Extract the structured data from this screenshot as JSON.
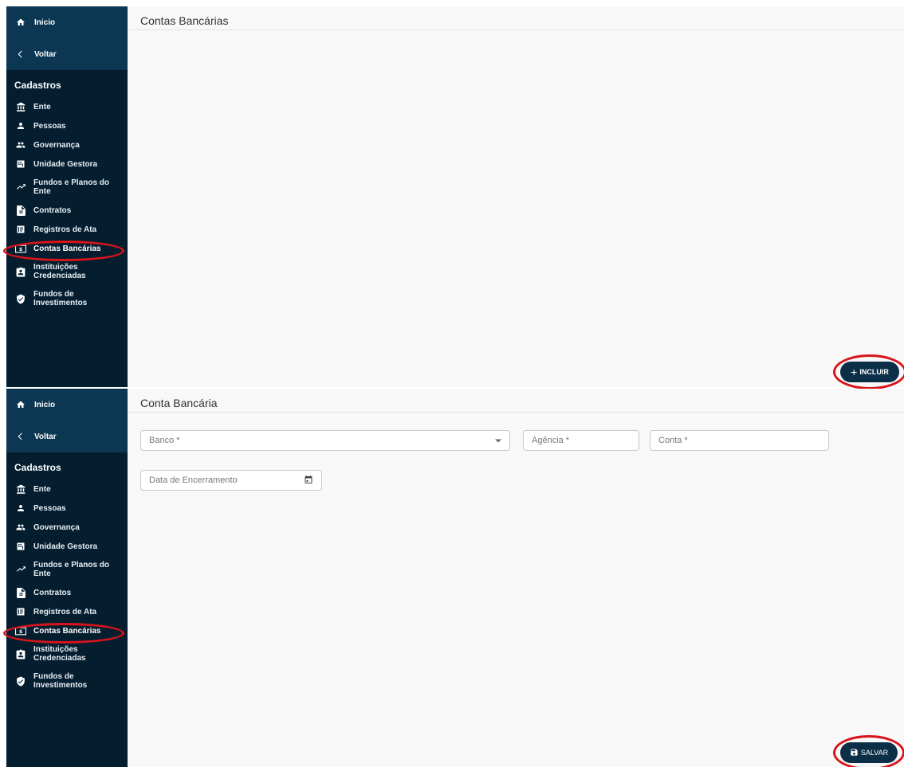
{
  "sidebar": {
    "home_label": "Inicio",
    "back_label": "Voltar",
    "section_title": "Cadastros",
    "items": [
      {
        "label": "Ente"
      },
      {
        "label": "Pessoas"
      },
      {
        "label": "Governança"
      },
      {
        "label": "Unidade Gestora"
      },
      {
        "label": "Fundos e Planos do Ente"
      },
      {
        "label": "Contratos"
      },
      {
        "label": "Registros de Ata"
      },
      {
        "label": "Contas Bancárias"
      },
      {
        "label": "Instituições Credenciadas"
      },
      {
        "label": "Fundos de Investimentos"
      }
    ]
  },
  "list_view": {
    "title": "Contas Bancárias",
    "add_button_label": "INCLUIR"
  },
  "form_view": {
    "title": "Conta Bancária",
    "banco_placeholder": "Banco *",
    "agencia_placeholder": "Agência *",
    "conta_placeholder": "Conta *",
    "data_encerramento_placeholder": "Data de Encerramento",
    "save_button_label": "SALVAR"
  },
  "colors": {
    "sidebar_bg": "#041e30",
    "sidebar_header_bg": "#0b3752",
    "button_bg": "#0b2f47",
    "highlight_ring": "#d8141b"
  }
}
